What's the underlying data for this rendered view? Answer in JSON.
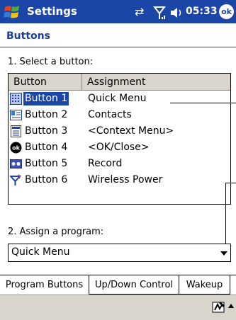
{
  "titlebar": {
    "app_title": "Settings",
    "time": "05:33",
    "ok_label": "ok",
    "connectivity_icon": "connectivity-icon",
    "signal_icon": "signal-icon",
    "volume_icon": "volume-icon"
  },
  "page": {
    "title": "Buttons",
    "select_label": "1. Select a button:",
    "assign_label": "2. Assign a program:"
  },
  "list": {
    "headers": [
      "Button",
      "Assignment"
    ],
    "rows": [
      {
        "name": "Button 1",
        "assignment": "Quick Menu",
        "icon": "quick-menu-icon",
        "selected": true
      },
      {
        "name": "Button 2",
        "assignment": "Contacts",
        "icon": "contacts-icon"
      },
      {
        "name": "Button 3",
        "assignment": "<Context Menu>",
        "icon": "context-menu-icon"
      },
      {
        "name": "Button 4",
        "assignment": "<OK/Close>",
        "icon": "ok-close-icon"
      },
      {
        "name": "Button 5",
        "assignment": "Record",
        "icon": "record-icon"
      },
      {
        "name": "Button 6",
        "assignment": "Wireless Power",
        "icon": "wireless-power-icon"
      }
    ]
  },
  "dropdown": {
    "value": "Quick Menu"
  },
  "tabs": [
    {
      "label": "Program Buttons",
      "active": true
    },
    {
      "label": "Up/Down Control"
    },
    {
      "label": "Wakeup"
    }
  ],
  "colors": {
    "titlebar": "#1c45a8",
    "selection": "#1c45a8",
    "menubar": "#d9d5cc"
  }
}
